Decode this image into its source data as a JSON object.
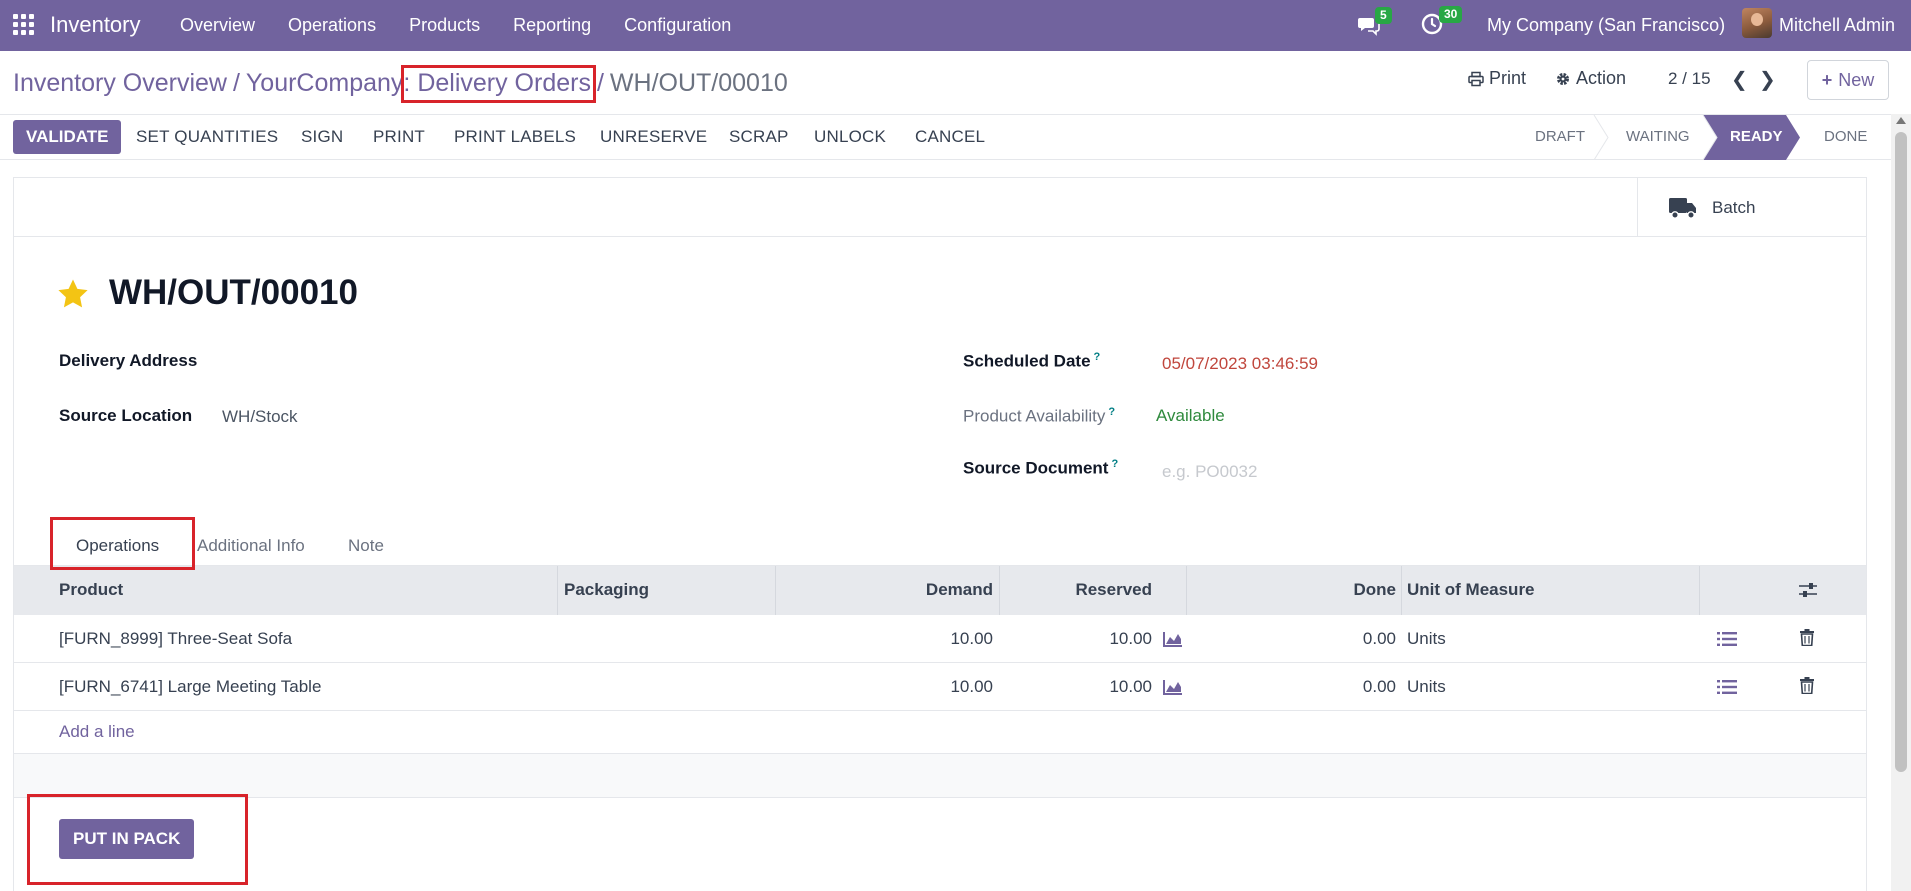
{
  "navbar": {
    "app_name": "Inventory",
    "menu": [
      "Overview",
      "Operations",
      "Products",
      "Reporting",
      "Configuration"
    ],
    "messages_count": "5",
    "activities_count": "30",
    "company": "My Company (San Francisco)",
    "user": "Mitchell Admin",
    "icons": [
      "apps-grid-icon",
      "chat-icon",
      "clock-icon",
      "avatar"
    ]
  },
  "breadcrumb": {
    "items": [
      "Inventory Overview",
      "YourCompany: Delivery Orders"
    ],
    "separator": "/",
    "current": "WH/OUT/00010"
  },
  "control": {
    "print_label": "Print",
    "action_label": "Action",
    "pager": "2 / 15",
    "new_label": "New"
  },
  "statusbar": {
    "buttons": [
      "VALIDATE",
      "SET QUANTITIES",
      "SIGN",
      "PRINT",
      "PRINT LABELS",
      "UNRESERVE",
      "SCRAP",
      "UNLOCK",
      "CANCEL"
    ],
    "stages": [
      "DRAFT",
      "WAITING",
      "READY",
      "DONE"
    ],
    "active_stage": "READY"
  },
  "smart_buttons": {
    "batch_label": "Batch"
  },
  "record": {
    "title": "WH/OUT/00010",
    "starred": true
  },
  "fields": {
    "delivery_address_label": "Delivery Address",
    "delivery_address_value": "",
    "source_location_label": "Source Location",
    "source_location_value": "WH/Stock",
    "scheduled_date_label": "Scheduled Date",
    "scheduled_date_value": "05/07/2023 03:46:59",
    "product_availability_label": "Product Availability",
    "product_availability_value": "Available",
    "source_document_label": "Source Document",
    "source_document_placeholder": "e.g. PO0032",
    "help_mark": "?"
  },
  "tabs": [
    "Operations",
    "Additional Info",
    "Note"
  ],
  "active_tab": "Operations",
  "table": {
    "columns": [
      "Product",
      "Packaging",
      "Demand",
      "Reserved",
      "Done",
      "Unit of Measure"
    ],
    "rows": [
      {
        "product": "[FURN_8999] Three-Seat Sofa",
        "packaging": "",
        "demand": "10.00",
        "reserved": "10.00",
        "done": "0.00",
        "uom": "Units"
      },
      {
        "product": "[FURN_6741] Large Meeting Table",
        "packaging": "",
        "demand": "10.00",
        "reserved": "10.00",
        "done": "0.00",
        "uom": "Units"
      }
    ],
    "add_line": "Add a line"
  },
  "put_in_pack_label": "PUT IN PACK",
  "colors": {
    "brand": "#71639e",
    "highlight": "#d8232a",
    "date_overdue": "#c0463c",
    "available": "#2f8a3d",
    "badge": "#28a745"
  }
}
